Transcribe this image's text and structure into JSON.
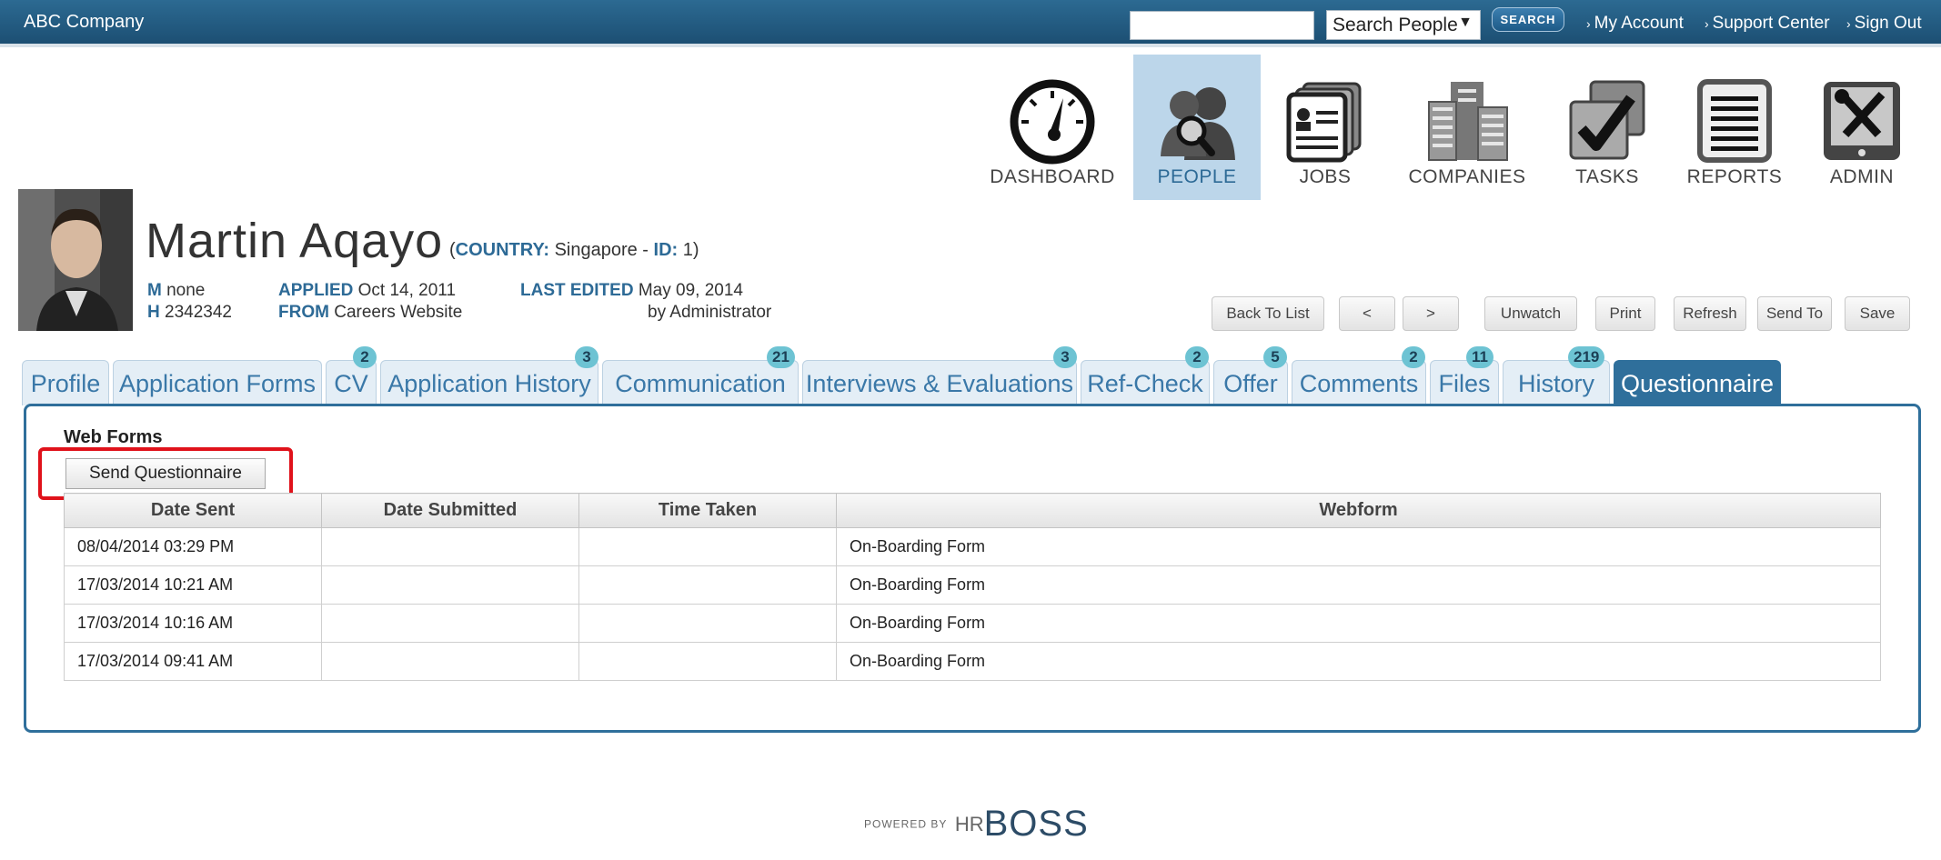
{
  "header": {
    "company": "ABC Company",
    "search_value": "",
    "search_scope": "Search People",
    "search_button": "SEARCH",
    "links": [
      "My Account",
      "Support Center",
      "Sign Out"
    ]
  },
  "nav": [
    {
      "label": "DASHBOARD",
      "icon": "dashboard-icon",
      "active": false
    },
    {
      "label": "PEOPLE",
      "icon": "people-icon",
      "active": true
    },
    {
      "label": "JOBS",
      "icon": "jobs-icon",
      "active": false
    },
    {
      "label": "COMPANIES",
      "icon": "companies-icon",
      "active": false
    },
    {
      "label": "TASKS",
      "icon": "tasks-icon",
      "active": false
    },
    {
      "label": "REPORTS",
      "icon": "reports-icon",
      "active": false
    },
    {
      "label": "ADMIN",
      "icon": "admin-icon",
      "active": false
    }
  ],
  "candidate": {
    "name": "Martin Aqayo",
    "country_label": "COUNTRY:",
    "country": "Singapore",
    "id_label": "ID:",
    "id": "1",
    "m_label": "M",
    "mobile": "none",
    "h_label": "H",
    "home": "2342342",
    "applied_label": "APPLIED",
    "applied": "Oct 14, 2011",
    "from_label": "FROM",
    "from": "Careers Website",
    "last_edited_label": "LAST EDITED",
    "last_edited": "May 09, 2014",
    "edited_by": "by Administrator"
  },
  "actions": [
    "Back To List",
    "<",
    ">",
    "Unwatch",
    "Print",
    "Refresh",
    "Send To",
    "Save"
  ],
  "tabs": [
    {
      "label": "Profile",
      "badge": ""
    },
    {
      "label": "Application Forms",
      "badge": ""
    },
    {
      "label": "CV",
      "badge": "2"
    },
    {
      "label": "Application History",
      "badge": "3"
    },
    {
      "label": "Communication",
      "badge": "21"
    },
    {
      "label": "Interviews & Evaluations",
      "badge": "3"
    },
    {
      "label": "Ref-Check",
      "badge": "2"
    },
    {
      "label": "Offer",
      "badge": "5"
    },
    {
      "label": "Comments",
      "badge": "2"
    },
    {
      "label": "Files",
      "badge": "11"
    },
    {
      "label": "History",
      "badge": "219"
    },
    {
      "label": "Questionnaire",
      "badge": ""
    }
  ],
  "panel": {
    "title": "Web Forms",
    "send_button": "Send Questionnaire",
    "columns": [
      "Date Sent",
      "Date Submitted",
      "Time Taken",
      "Webform"
    ],
    "rows": [
      [
        "08/04/2014 03:29 PM",
        "",
        "",
        "On-Boarding Form"
      ],
      [
        "17/03/2014 10:21 AM",
        "",
        "",
        "On-Boarding Form"
      ],
      [
        "17/03/2014 10:16 AM",
        "",
        "",
        "On-Boarding Form"
      ],
      [
        "17/03/2014 09:41 AM",
        "",
        "",
        "On-Boarding Form"
      ]
    ]
  },
  "footer": {
    "powered_by": "POWERED BY",
    "brand_prefix": "HR",
    "brand": "BOSS"
  },
  "colors": {
    "topbar": "#1c4f73",
    "accent": "#2f6f9b",
    "badge": "#6dc3d3",
    "highlight": "#e0121b"
  }
}
